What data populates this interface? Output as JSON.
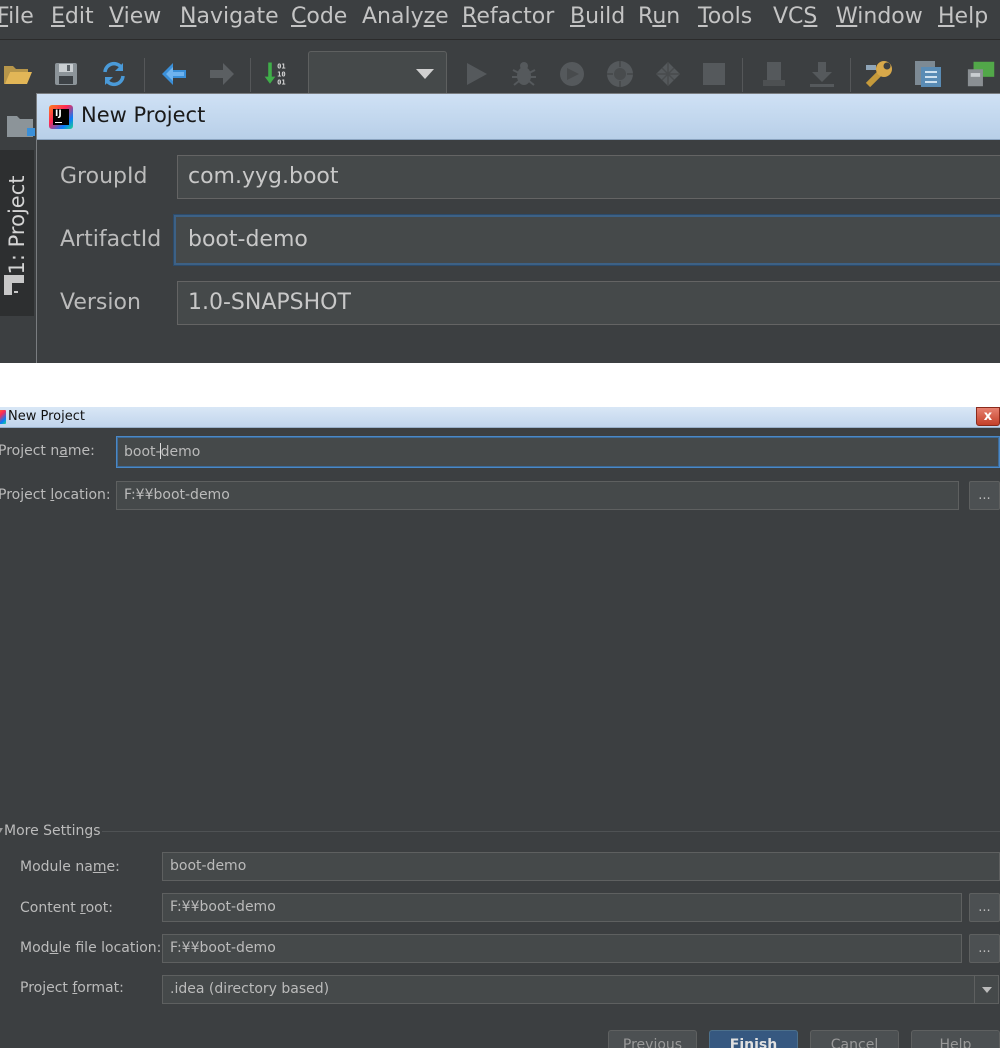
{
  "menubar": {
    "items": [
      {
        "pre": "",
        "u": "F",
        "post": "ile"
      },
      {
        "pre": "",
        "u": "E",
        "post": "dit"
      },
      {
        "pre": "",
        "u": "V",
        "post": "iew"
      },
      {
        "pre": "",
        "u": "N",
        "post": "avigate"
      },
      {
        "pre": "",
        "u": "C",
        "post": "ode"
      },
      {
        "pre": "Analy",
        "u": "z",
        "post": "e"
      },
      {
        "pre": "",
        "u": "R",
        "post": "efactor"
      },
      {
        "pre": "",
        "u": "B",
        "post": "uild"
      },
      {
        "pre": "R",
        "u": "u",
        "post": "n"
      },
      {
        "pre": "",
        "u": "T",
        "post": "ools"
      },
      {
        "pre": "VC",
        "u": "S",
        "post": ""
      },
      {
        "pre": "",
        "u": "W",
        "post": "indow"
      },
      {
        "pre": "",
        "u": "H",
        "post": "elp"
      }
    ]
  },
  "toolbar": {
    "icons": [
      "open-folder-icon",
      "save-icon",
      "sync-icon",
      "back-arrow-icon",
      "forward-arrow-icon",
      "binary-update-icon",
      "run-icon",
      "debug-icon",
      "coverage-icon",
      "profile-icon",
      "concurrency-icon",
      "stop-icon",
      "attach-icon",
      "download-icon",
      "settings-wrench-icon",
      "structure-icon",
      "sdk-icon"
    ],
    "run_config": ""
  },
  "side_panel": {
    "project_tab": "1: Project"
  },
  "dialog_top": {
    "title": "New Project",
    "fields": {
      "group_id": {
        "label": "GroupId",
        "value": "com.yyg.boot"
      },
      "artifact_id": {
        "label": "ArtifactId",
        "value": "boot-demo"
      },
      "version": {
        "label": "Version",
        "value": "1.0-SNAPSHOT"
      }
    }
  },
  "dialog_bottom": {
    "title": "New Project",
    "close": "x",
    "project_name": {
      "label_pre": "Project n",
      "label_u": "a",
      "label_post": "me:",
      "value_pre": "boot-",
      "value_post": "demo"
    },
    "project_location": {
      "label_pre": "Project ",
      "label_u": "l",
      "label_post": "ocation:",
      "value": "F:¥¥boot-demo",
      "browse": "..."
    },
    "more_settings": {
      "label_pre": "Mor",
      "label_u": "e",
      "label_post": " Settings"
    },
    "module_name": {
      "label_pre": "Module na",
      "label_u": "m",
      "label_post": "e:",
      "value": "boot-demo"
    },
    "content_root": {
      "label_pre": "Content ",
      "label_u": "r",
      "label_post": "oot:",
      "value": "F:¥¥boot-demo",
      "browse": "..."
    },
    "module_file_location": {
      "label_pre": "Mod",
      "label_u": "u",
      "label_post": "le file location:",
      "value": "F:¥¥boot-demo",
      "browse": "..."
    },
    "project_format": {
      "label_pre": "Project ",
      "label_u": "f",
      "label_post": "ormat:",
      "value": ".idea (directory based)"
    },
    "buttons": {
      "previous": {
        "pre": "",
        "u": "P",
        "post": "revious"
      },
      "finish": {
        "pre": "",
        "u": "F",
        "post": "inish"
      },
      "cancel": "Cancel",
      "help": "Help"
    }
  },
  "colors": {
    "ide_bg": "#3c3f41",
    "field_bg": "#45494a",
    "focus_border": "#4a88c7",
    "primary_button": "#365880",
    "text": "#bbbbbb"
  }
}
